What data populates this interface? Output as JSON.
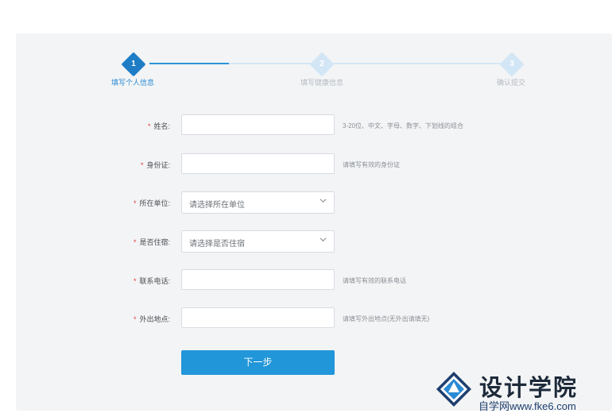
{
  "steps": [
    {
      "number": "1",
      "label": "填写个人信息"
    },
    {
      "number": "2",
      "label": "填写健康信息"
    },
    {
      "number": "3",
      "label": "确认提交"
    }
  ],
  "form": {
    "name": {
      "label": "姓名:",
      "required": "*",
      "value": "",
      "hint": "3-20位、中文、字母、数字、下划线的组合"
    },
    "id_card": {
      "label": "身份证:",
      "required": "*",
      "value": "",
      "hint": "请填写有效的身份证"
    },
    "unit": {
      "label": "所在单位:",
      "required": "*",
      "selected": "请选择所在单位"
    },
    "residence": {
      "label": "是否住宿:",
      "required": "*",
      "selected": "请选择是否住宿"
    },
    "phone": {
      "label": "联系电话:",
      "required": "*",
      "value": "",
      "hint": "请填写有效的联系电话"
    },
    "outing": {
      "label": "外出地点:",
      "required": "*",
      "value": "",
      "hint": "请填写外出地点(无外出请填无)"
    }
  },
  "next_button": "下一步",
  "watermark": {
    "title": "设计学院",
    "url": "自学网www.fke6.com"
  },
  "colors": {
    "accent": "#2196d9",
    "required": "#e03b3b",
    "panel": "#f3f4f5"
  },
  "icons": {
    "dropdown": "chevron-down-icon",
    "logo": "diamond-logo-icon"
  }
}
